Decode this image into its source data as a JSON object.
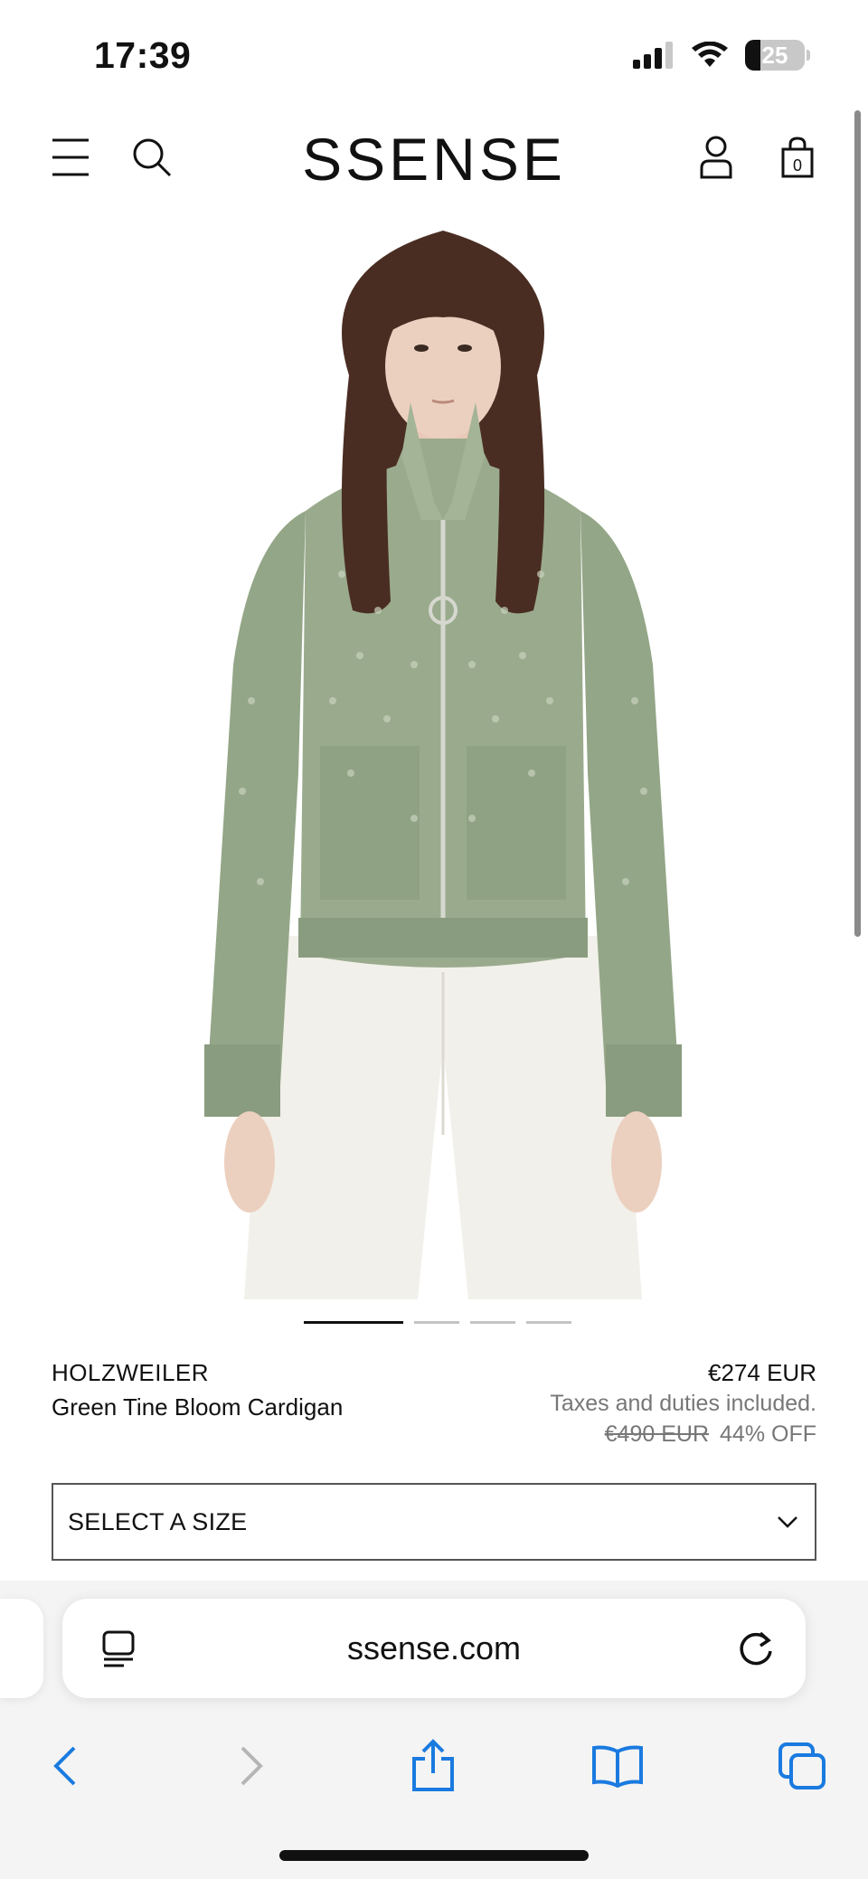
{
  "status_bar": {
    "time": "17:39",
    "battery_level": "25",
    "icons": [
      "signal-icon",
      "wifi-icon",
      "battery-icon"
    ]
  },
  "header": {
    "logo": "SSENSE",
    "cart_count": "0",
    "icons": [
      "menu-icon",
      "search-icon",
      "account-icon",
      "bag-icon"
    ]
  },
  "carousel": {
    "total": 4,
    "active_index": 0
  },
  "product": {
    "brand": "HOLZWEILER",
    "name": "Green Tine Bloom Cardigan",
    "price": "€274 EUR",
    "tax_note": "Taxes and duties included.",
    "original_price": "€490 EUR",
    "discount": "44% OFF",
    "image_colors": {
      "cardigan": "#9aab8d",
      "pants": "#f2f0ea",
      "hair": "#4a2d22",
      "skin": "#e9c9b8"
    }
  },
  "size_select": {
    "label": "SELECT A SIZE"
  },
  "browser": {
    "url": "ssense.com",
    "accent": "#1a7ae0",
    "toolbar": [
      "back-icon",
      "forward-icon",
      "share-icon",
      "bookmarks-icon",
      "tabs-icon"
    ]
  }
}
